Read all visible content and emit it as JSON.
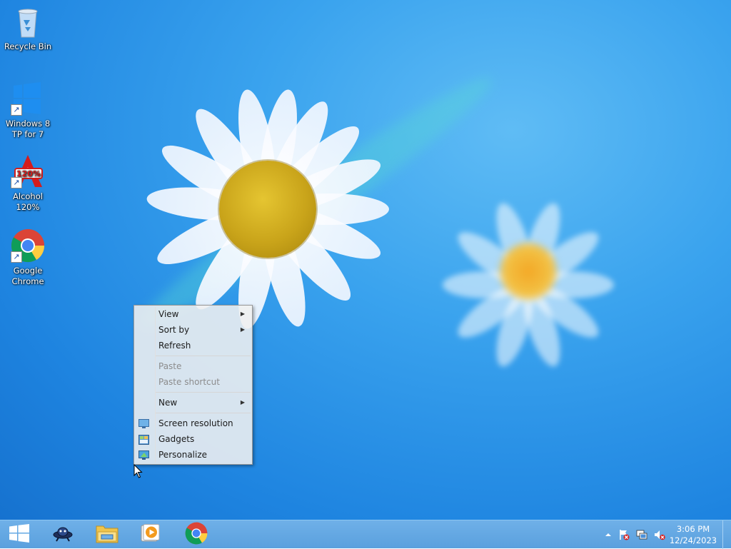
{
  "desktop_icons": [
    {
      "label": "Recycle Bin",
      "icon": "recycle-bin-icon"
    },
    {
      "label": "Windows 8 TP for 7",
      "icon": "windows-logo-icon"
    },
    {
      "label": "Alcohol 120%",
      "icon": "alcohol-120-icon"
    },
    {
      "label": "Google Chrome",
      "icon": "chrome-icon"
    }
  ],
  "context_menu": {
    "items": [
      {
        "label": "View",
        "has_submenu": true,
        "enabled": true
      },
      {
        "label": "Sort by",
        "has_submenu": true,
        "enabled": true
      },
      {
        "label": "Refresh",
        "enabled": true
      },
      {
        "label": "Paste",
        "enabled": false
      },
      {
        "label": "Paste shortcut",
        "enabled": false
      },
      {
        "label": "New",
        "has_submenu": true,
        "enabled": true
      },
      {
        "label": "Screen resolution",
        "enabled": true,
        "icon": "screen-resolution-icon"
      },
      {
        "label": "Gadgets",
        "enabled": true,
        "icon": "gadgets-icon"
      },
      {
        "label": "Personalize",
        "enabled": true,
        "icon": "personalize-icon"
      }
    ]
  },
  "taskbar": {
    "pinned": [
      {
        "name": "start",
        "icon": "windows-start-icon"
      },
      {
        "name": "app",
        "icon": "ufo-app-icon"
      },
      {
        "name": "file-explorer",
        "icon": "folder-icon"
      },
      {
        "name": "media-player",
        "icon": "media-player-icon"
      },
      {
        "name": "chrome",
        "icon": "chrome-icon"
      }
    ],
    "tray": {
      "icons": [
        "show-hidden-icons-icon",
        "action-center-flag-icon",
        "network-icon",
        "volume-muted-icon"
      ],
      "time": "3:06 PM",
      "date": "12/24/2023"
    }
  },
  "colors": {
    "desktop": "#2a95e8",
    "taskbar": "#62a6e2",
    "menu_background": "#f0f0f0",
    "disabled_text": "#8c8c8c"
  }
}
